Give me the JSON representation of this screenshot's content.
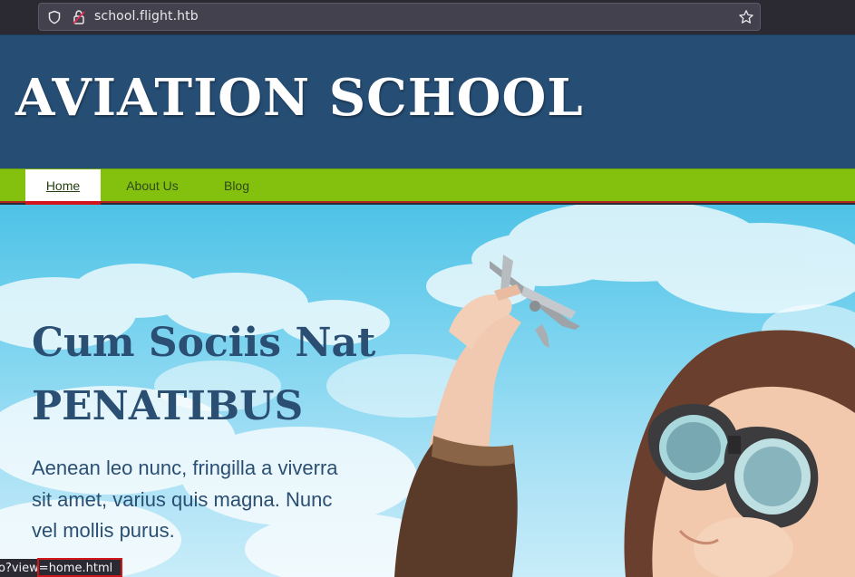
{
  "browser": {
    "url": "school.flight.htb",
    "icons": [
      "shield-icon",
      "lock-icon",
      "star-icon"
    ]
  },
  "site": {
    "title": "AVIATION SCHOOL",
    "colors": {
      "header": "#264e75",
      "nav": "#84c10f",
      "accent": "#d0161b",
      "heading": "#2a4f73"
    }
  },
  "nav": {
    "items": [
      {
        "label": "Home",
        "active": true
      },
      {
        "label": "About Us",
        "active": false
      },
      {
        "label": "Blog",
        "active": false
      }
    ]
  },
  "hero": {
    "heading_line1": "Cum Sociis Nat",
    "heading_line2": "PENATIBUS",
    "text": "Aenean leo nunc, fringilla a viverra sit amet, varius quis magna. Nunc vel mollis purus."
  },
  "status": {
    "link_prefix": "o?view",
    "link_highlight": "=home.html"
  }
}
